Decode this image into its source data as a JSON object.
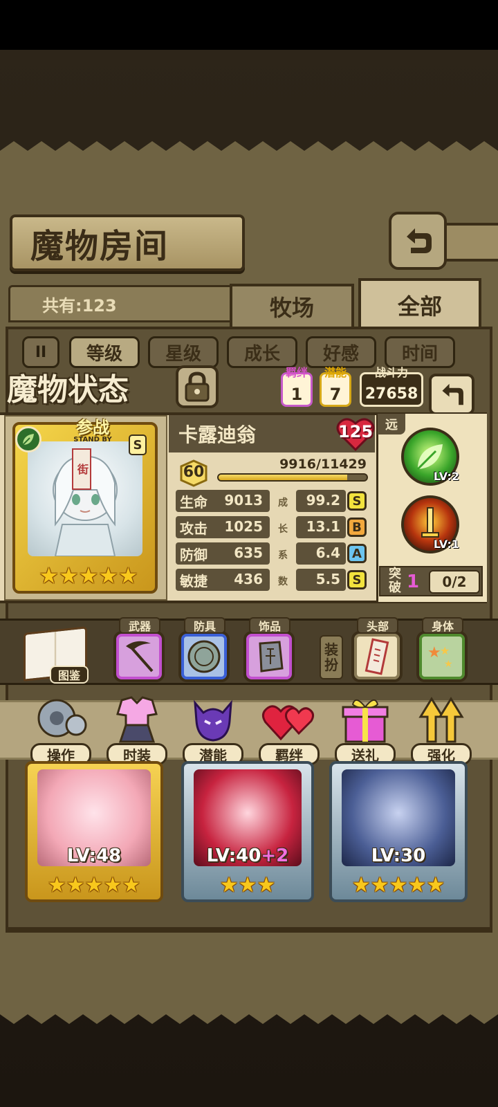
{
  "header": {
    "title": "魔物房间",
    "back_icon": "return-arrow-icon",
    "count_label": "共有:123",
    "tabs": [
      {
        "label": "牧场",
        "selected": false
      },
      {
        "label": "全部",
        "selected": true
      }
    ]
  },
  "sort": {
    "toggle_label": "II",
    "options": [
      {
        "label": "等级",
        "selected": true
      },
      {
        "label": "星级",
        "selected": false
      },
      {
        "label": "成长",
        "selected": false
      },
      {
        "label": "好感",
        "selected": false
      },
      {
        "label": "时间",
        "selected": false
      }
    ]
  },
  "status": {
    "title": "魔物状态",
    "lock_icon": "lock-icon",
    "bond": {
      "label": "羁绊",
      "value": "1"
    },
    "potential": {
      "label": "潜能",
      "value": "7"
    },
    "power": {
      "label": "战斗力",
      "value": "27658"
    },
    "back_icon": "return-arrow-icon"
  },
  "monster": {
    "name": "卡露迪翁",
    "heart_value": "125",
    "standby_label": "参战",
    "standby_sub": "STAND BY",
    "rank": "S",
    "card_tag": "街",
    "stars": 5,
    "element_icon": "leaf-icon",
    "level": "60",
    "exp_text": "9916/11429",
    "exp_fraction": 0.8676,
    "stats": [
      {
        "label": "生命",
        "value": "9013",
        "growth": "99.2",
        "grade": "S"
      },
      {
        "label": "攻击",
        "value": "1025",
        "growth": "13.1",
        "grade": "B"
      },
      {
        "label": "防御",
        "value": "635",
        "growth": "6.4",
        "grade": "A"
      },
      {
        "label": "敏捷",
        "value": "436",
        "growth": "5.5",
        "grade": "S"
      }
    ],
    "growth_chars": [
      "成",
      "长",
      "系",
      "数"
    ],
    "range": "远",
    "skills": [
      {
        "icon": "leaf-skill-icon",
        "level": "LV:2"
      },
      {
        "icon": "fire-sword-skill-icon",
        "level": "LV:1"
      }
    ],
    "breakthrough": {
      "label": "突破",
      "count": "1",
      "progress": "0/2"
    }
  },
  "equipment": {
    "codex_label": "图鉴",
    "dress_up_label": "装扮",
    "slots": [
      {
        "label": "武器",
        "icon": "scythe-icon"
      },
      {
        "label": "防具",
        "icon": "shield-coin-icon"
      },
      {
        "label": "饰品",
        "icon": "stone-tablet-icon"
      },
      {
        "label": "头部",
        "icon": "talisman-icon"
      },
      {
        "label": "身体",
        "icon": "stars-icon"
      }
    ]
  },
  "actions": [
    {
      "label": "操作",
      "icon": "gear-icon"
    },
    {
      "label": "时装",
      "icon": "outfit-icon"
    },
    {
      "label": "潜能",
      "icon": "demon-icon"
    },
    {
      "label": "羁绊",
      "icon": "hearts-icon"
    },
    {
      "label": "送礼",
      "icon": "gift-icon"
    },
    {
      "label": "强化",
      "icon": "up-arrows-icon"
    }
  ],
  "list_cards": [
    {
      "level": "LV:48",
      "plus": "",
      "stars": 5
    },
    {
      "level": "LV:40",
      "plus": "+2",
      "stars": 3
    },
    {
      "level": "LV:30",
      "plus": "",
      "stars": 5
    }
  ],
  "colors": {
    "parchment": "#6f6343",
    "panel": "#e6d8b4",
    "dark_label": "#5d5139",
    "gold": "#f8c81c",
    "bond_pink": "#d64fc9",
    "potential_gold": "#e0a700"
  }
}
